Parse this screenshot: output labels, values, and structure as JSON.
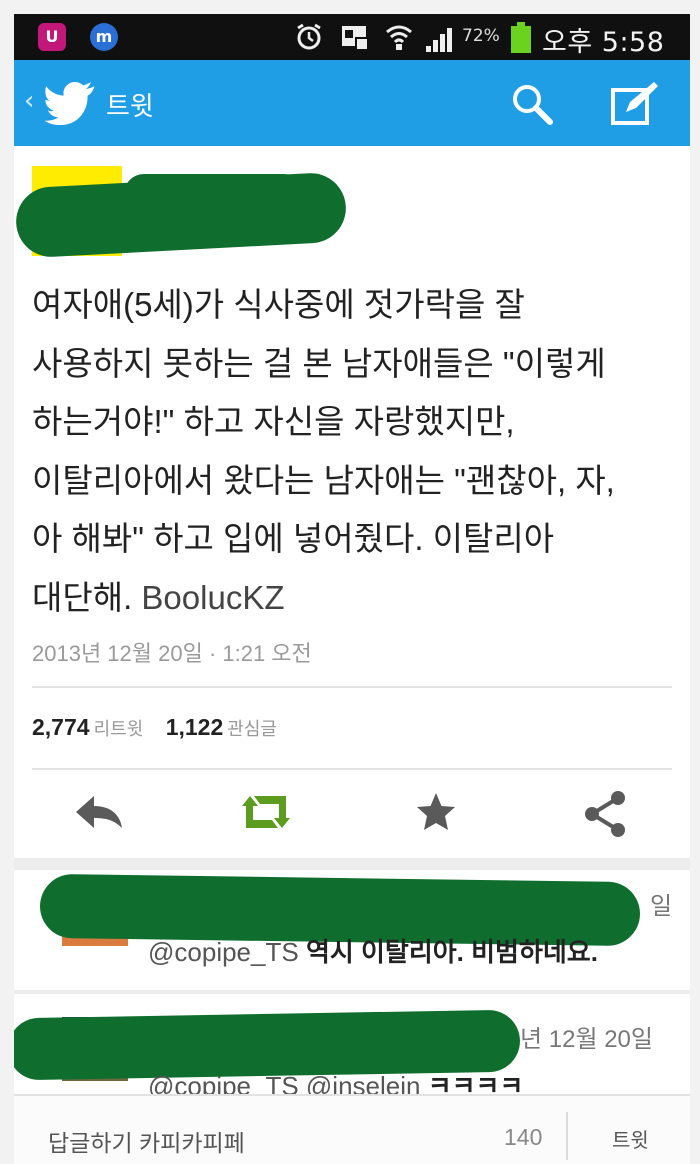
{
  "status_bar": {
    "battery_percent": "72%",
    "clock": "오후 5:58",
    "icons": [
      "lg-uplus-icon",
      "messenger-icon",
      "alarm-icon",
      "gallery-notification-icon",
      "wifi-icon",
      "signal-icon",
      "battery-icon"
    ]
  },
  "header": {
    "title": "트윗",
    "icons": [
      "back-chevron-icon",
      "twitter-bird-icon",
      "search-icon",
      "compose-icon"
    ]
  },
  "tweet": {
    "lines": [
      "여자애(5세)가 식사중에 젓가락을 잘",
      "사용하지 못하는 걸 본 남자애들은 \"이렇게",
      "하는거야!\" 하고 자신을 자랑했지만,",
      "이탈리아에서 왔다는 남자애는 \"괜찮아, 자,",
      "아 해봐\" 하고 입에 넣어줬다. 이탈리아",
      "대단해."
    ],
    "signature": "BoolucKZ",
    "timestamp": "2013년 12월 20일 · 1:21 오전",
    "retweet_count": "2,774",
    "retweet_label": "리트윗",
    "favorite_count": "1,122",
    "favorite_label": "관심글"
  },
  "actions": {
    "icons": [
      "reply-icon",
      "retweet-icon",
      "favorite-star-icon",
      "share-icon"
    ],
    "retweet_color": "#5c9c1f"
  },
  "replies": [
    {
      "date_fragment": "일",
      "handles": "@copipe_TS",
      "text": "역시 이탈리아. 비범하네요."
    },
    {
      "date_fragment": "년 12월 20일",
      "handles": "@copipe_TS @inselein",
      "text": "ㅋㅋㅋㅋ"
    }
  ],
  "composer": {
    "placeholder": "답글하기 카피카피페",
    "char_count": "140",
    "send_label": "트윗"
  },
  "colors": {
    "action_bar": "#1f9de5",
    "redaction": "#0f6e2d",
    "avatar_yellow": "#ffec00"
  }
}
